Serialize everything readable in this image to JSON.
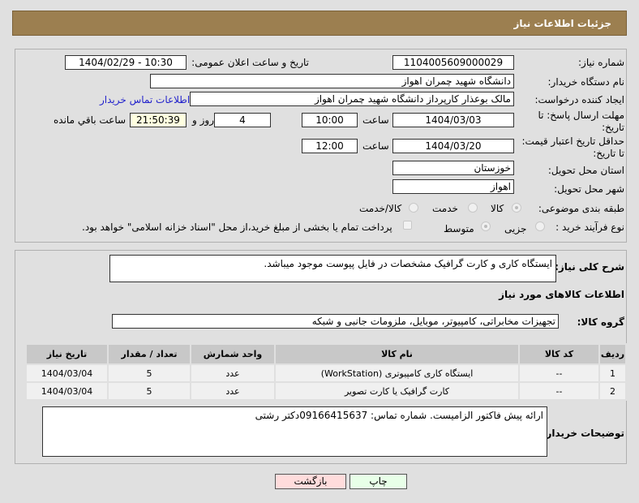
{
  "header": {
    "title": "جزئیات اطلاعات نیاز"
  },
  "fields": {
    "need_number_label": "شماره نیاز:",
    "need_number": "1104005609000029",
    "announce_label": "تاریخ و ساعت اعلان عمومی:",
    "announce_value": "1404/02/29 - 10:30",
    "buyer_org_label": "نام دستگاه خریدار:",
    "buyer_org": "دانشگاه شهید چمران اهواز",
    "creator_label": "ایجاد کننده درخواست:",
    "creator": "مالک بوعذار کارپرداز دانشگاه شهید چمران اهواز",
    "contact_link": "اطلاعات تماس خریدار",
    "deadline_label": "مهلت ارسال پاسخ: تا تاریخ:",
    "deadline_date": "1404/03/03",
    "hour_label": "ساعت",
    "deadline_time": "10:00",
    "days": "4",
    "days_label": "روز و",
    "remaining": "21:50:39",
    "remaining_label": "ساعت باقي مانده",
    "validity_label": "حداقل تاریخ اعتبار قیمت: تا تاریخ:",
    "validity_date": "1404/03/20",
    "validity_time": "12:00",
    "province_label": "استان محل تحویل:",
    "province": "خوزستان",
    "city_label": "شهر محل تحویل:",
    "city": "اهواز",
    "category_label": "طبقه بندی موضوعی:",
    "category_options": [
      "کالا",
      "خدمت",
      "کالا/خدمت"
    ],
    "process_label": "نوع فرآیند خرید :",
    "process_options": [
      "جزیی",
      "متوسط"
    ],
    "payment_note": "پرداخت تمام یا بخشی از مبلغ خرید،از محل \"اسناد خزانه اسلامی\" خواهد بود."
  },
  "description": {
    "label": "شرح کلی نیاز:",
    "value": "ایستگاه کاری و کارت گرافیک مشخصات در فایل پیوست موجود میباشد."
  },
  "goods": {
    "title": "اطلاعات کالاهای مورد نیاز",
    "group_label": "گروه کالا:",
    "group": "تجهیزات مخابراتی، کامپیوتر، موبایل، ملزومات جانبی و شبکه"
  },
  "table": {
    "headers": [
      "ردیف",
      "کد کالا",
      "نام کالا",
      "واحد شمارش",
      "تعداد / مقدار",
      "تاریخ نیاز"
    ],
    "rows": [
      [
        "1",
        "--",
        "ایستگاه کاری کامپیوتری (WorkStation)",
        "عدد",
        "5",
        "1404/03/04"
      ],
      [
        "2",
        "--",
        "کارت گرافیک یا کارت تصویر",
        "عدد",
        "5",
        "1404/03/04"
      ]
    ]
  },
  "notes": {
    "label": "توضیحات خریدار:",
    "value": "ارائه پیش فاکتور الزامیست. شماره تماس: 09166415637دکتر رشتی"
  },
  "buttons": {
    "print": "چاپ",
    "back": "بازگشت"
  }
}
